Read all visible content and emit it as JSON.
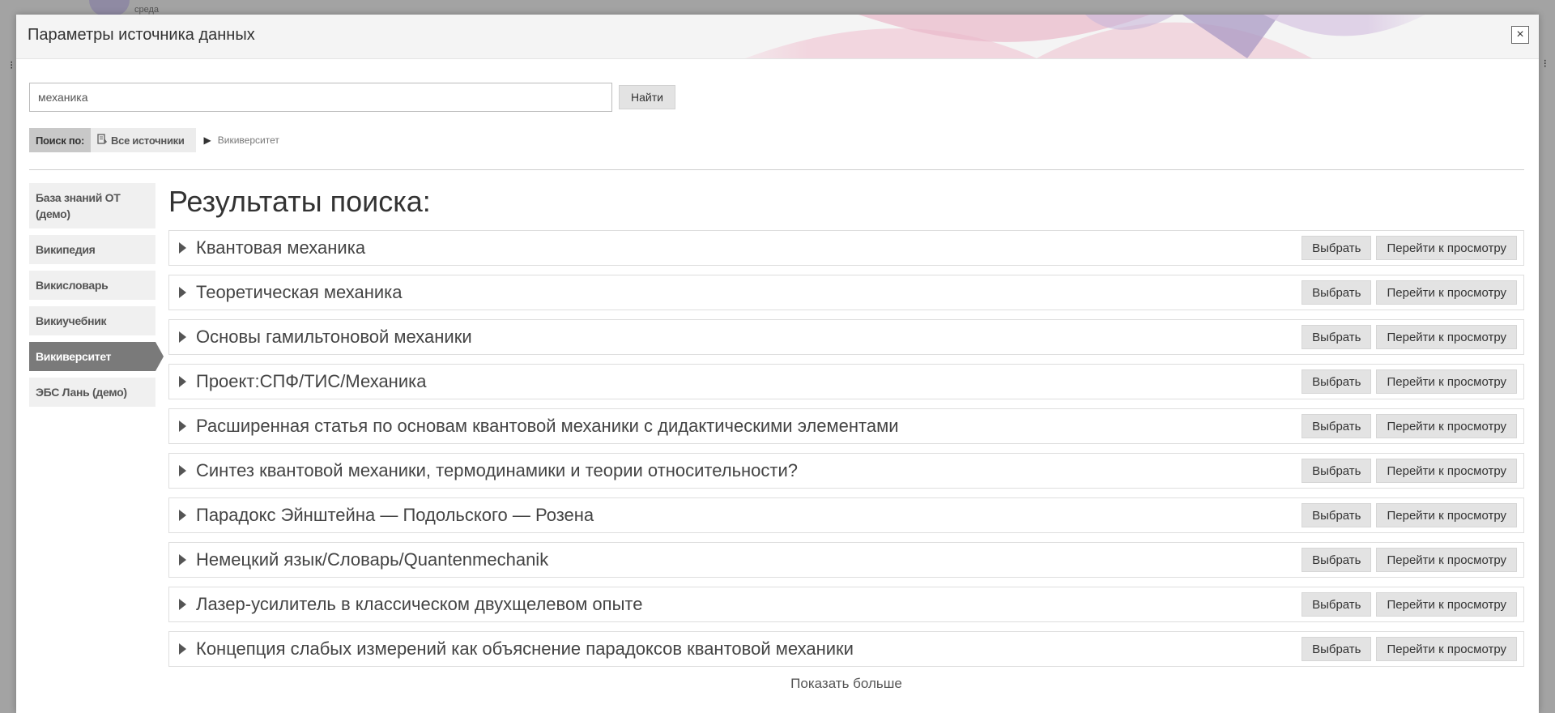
{
  "background": {
    "logo_text": "среда"
  },
  "modal": {
    "title": "Параметры источника данных",
    "close_symbol": "×"
  },
  "search": {
    "value": "механика",
    "button_label": "Найти"
  },
  "scope": {
    "label": "Поиск по:",
    "all_sources": "Все источники",
    "arrow": "▶",
    "current": "Викиверситет"
  },
  "sidebar": {
    "items": [
      {
        "label": "База знаний ОТ (демо)",
        "active": false
      },
      {
        "label": "Википедия",
        "active": false
      },
      {
        "label": "Викисловарь",
        "active": false
      },
      {
        "label": "Викиучебник",
        "active": false
      },
      {
        "label": "Викиверситет",
        "active": true
      },
      {
        "label": "ЭБС Лань (демо)",
        "active": false
      }
    ]
  },
  "results": {
    "heading": "Результаты поиска:",
    "select_label": "Выбрать",
    "view_label": "Перейти к просмотру",
    "items": [
      "Квантовая механика",
      "Теоретическая механика",
      "Основы гамильтоновой механики",
      "Проект:СПФ/ТИС/Механика",
      "Расширенная статья по основам квантовой механики с дидактическими элементами",
      "Синтез квантовой механики, термодинамики и теории относительности?",
      "Парадокс Эйнштейна — Подольского — Розена",
      "Немецкий язык/Словарь/Quantenmechanik",
      "Лазер-усилитель в классическом двухщелевом опыте",
      "Концепция слабых измерений как объяснение парадоксов квантовой механики"
    ],
    "show_more": "Показать больше"
  },
  "colors": {
    "active_tab": "#7a7a7a",
    "button_bg": "#e3e3e3",
    "header_decor_pink": "#e9b8c9",
    "header_decor_purple": "#a99ac4"
  }
}
